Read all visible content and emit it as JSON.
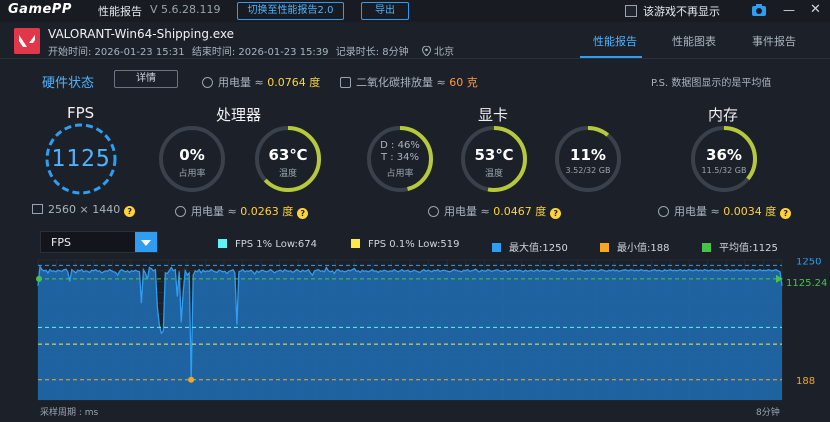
{
  "titlebar": {
    "logo": "GamePP",
    "title": "性能报告",
    "version": "V 5.6.28.119",
    "switch_button": "切换至性能报告2.0",
    "export_button": "导出",
    "hide_checkbox_label": "该游戏不再显示"
  },
  "session": {
    "game_name": "VALORANT-Win64-Shipping.exe",
    "start": "开始时间: 2026-01-23 15:31",
    "end": "结束时间: 2026-01-23 15:39",
    "duration": "记录时长: 8分钟",
    "location": "北京"
  },
  "tabs": [
    "性能报告",
    "性能图表",
    "事件报告"
  ],
  "hardware": {
    "label": "硬件状态",
    "detail_button": "详情",
    "power_label": "用电量 ≈ ",
    "power_value": "0.0764 度",
    "co2_label": "二氧化碳排放量 ≈ ",
    "co2_value": "60 克",
    "note": "P.S. 数据图显示的是平均值"
  },
  "sections": {
    "fps": "FPS",
    "cpu": "处理器",
    "gpu": "显卡",
    "mem": "内存"
  },
  "fps_value": "1125",
  "resolution": "2560 × 1440",
  "cpu": {
    "usage": "0%",
    "usage_label": "占用率",
    "usage_fraction": 0.0,
    "temp": "63℃",
    "temp_label": "温度",
    "temp_fraction": 0.63,
    "power_label": "用电量 ≈ ",
    "power_value": "0.0263 度"
  },
  "gpu": {
    "d_line": "D : 46%",
    "t_line": "T : 34%",
    "usage_label": "占用率",
    "usage_fraction": 0.46,
    "temp": "53℃",
    "temp_label": "温度",
    "temp_fraction": 0.53,
    "vram": "11%",
    "vram_sub": "3.52/32 GB",
    "vram_fraction": 0.11,
    "power_label": "用电量 ≈ ",
    "power_value": "0.0467 度"
  },
  "mem": {
    "usage": "36%",
    "sub": "11.5/32 GB",
    "fraction": 0.36,
    "power_label": "用电量 ≈ ",
    "power_value": "0.0034 度"
  },
  "chart_controls": {
    "selected_metric": "FPS",
    "legend": [
      {
        "label": "FPS 1% Low:674",
        "color": "#5ff2f2"
      },
      {
        "label": "FPS 0.1% Low:519",
        "color": "#ffe84a"
      },
      {
        "label": "最大值:1250",
        "color": "#2f9df2"
      },
      {
        "label": "最小值:188",
        "color": "#f5a623"
      },
      {
        "label": "平均值:1125",
        "color": "#47c24a"
      }
    ]
  },
  "chart_data": {
    "type": "area",
    "metric": "FPS",
    "x_range_minutes": [
      0,
      8
    ],
    "ylim": [
      0,
      1300
    ],
    "reference_lines": {
      "max": 1250,
      "avg": 1125.24,
      "low1": 674,
      "low01": 519,
      "min": 188
    },
    "axis_labels": {
      "max": "1250",
      "avg": "1125.24",
      "min": "188"
    },
    "x_end_label": "8分钟",
    "values": [
      1060,
      1240,
      1210,
      1200,
      1205,
      1180,
      1210,
      1195,
      1200,
      1190,
      1205,
      1200,
      1195,
      1210,
      1215,
      1190,
      1100,
      1210,
      1195,
      1180,
      1205,
      1200,
      1210,
      1190,
      1200,
      1195,
      1185,
      1205,
      1200,
      1210,
      1195,
      1200,
      1180,
      1190,
      1200,
      1195,
      1210,
      1200,
      1190,
      1185,
      1160,
      1195,
      1210,
      1200,
      1190,
      1200,
      1185,
      1200,
      1195,
      1205,
      1195,
      1190,
      900,
      1210,
      1180,
      1120,
      1230,
      1220,
      1200,
      1210,
      860,
      700,
      620,
      640,
      1180,
      1175,
      1200,
      1230,
      1200,
      1210,
      960,
      1195,
      720,
      1000,
      1200,
      1160,
      1180,
      190,
      1160,
      1200,
      1190,
      1210,
      1180,
      1205,
      1190,
      1200,
      1195,
      1210,
      1200,
      1190,
      1185,
      1205,
      1200,
      1190,
      1195,
      1175,
      1195,
      1200,
      1210,
      1180,
      700,
      1190,
      1200,
      1210,
      1190,
      1200,
      1195,
      1205,
      1190,
      1170,
      1200,
      1185,
      1200,
      1205,
      1195,
      1190,
      1200,
      1210,
      1195,
      1180,
      1195,
      1200,
      1205,
      1190,
      1210,
      1200,
      1195,
      1200,
      1185,
      1195,
      1210,
      1200,
      1190,
      1205,
      1195,
      1200,
      1210,
      1180,
      1160,
      1200,
      1205,
      1210,
      1195,
      1200,
      1190,
      1230,
      1200,
      1190,
      1200,
      1175,
      1205,
      1210,
      1195,
      1200,
      1190,
      1195,
      1205,
      1200,
      1210,
      1220,
      1195,
      1200,
      1185,
      1205,
      1195,
      1200,
      1190,
      1200,
      1210,
      1195,
      1200,
      1185,
      1200,
      1195,
      1205,
      1200,
      1190,
      1200,
      1195,
      1210,
      1200,
      1190,
      1200,
      1210,
      1195,
      1200,
      1205,
      1190,
      1195,
      1205,
      1200,
      1190,
      1185,
      1200,
      1210,
      1195,
      1205,
      1200,
      1190,
      1205,
      1200,
      1210,
      1195,
      1200,
      1205,
      1200,
      1195,
      1190,
      1200,
      1210,
      1205,
      1200,
      1195,
      1190,
      1205,
      1200,
      1210,
      1195,
      1200,
      1205,
      1215,
      1200,
      1190,
      1205,
      1200,
      1195,
      1210,
      1205,
      1195,
      1200,
      1205,
      1210,
      1200,
      1195,
      1200,
      1205,
      1190,
      1200,
      1205,
      1200,
      1210,
      1200,
      1205,
      1200,
      1190,
      1205,
      1195,
      1200,
      1205,
      1195,
      1200,
      1210,
      1195,
      1200,
      1205,
      1200,
      1200,
      1195,
      1210,
      1205,
      1200,
      1195,
      1200,
      1205,
      1210,
      1200,
      1205,
      1195,
      1200,
      1205,
      1200,
      1200,
      1210,
      1205,
      1200,
      1195,
      1205,
      1200,
      1210,
      1200,
      1205,
      1195,
      1200,
      1210,
      1205,
      1200,
      1195,
      1205,
      1200,
      1210,
      1200,
      1205,
      1195,
      1200,
      1205,
      1210,
      1205,
      1200,
      1210,
      1205,
      1200,
      1205,
      1200,
      1210,
      1205,
      1200,
      1205,
      1195,
      1200,
      1205,
      1210,
      1200,
      1205,
      1200,
      1195,
      1210,
      1200,
      1205,
      1210,
      1200,
      1205,
      1200,
      1205,
      1210,
      1200,
      1205,
      1200,
      1210,
      1205,
      1200,
      1205,
      1210,
      1200,
      1205,
      1200,
      1210,
      1205,
      1200,
      1205,
      1210,
      1200,
      1205,
      1200,
      1210,
      1205,
      1200,
      1205,
      1210,
      1200,
      1205,
      1200,
      1210,
      1205,
      1200,
      1205,
      1210,
      1200,
      1205,
      1200,
      1210,
      1205,
      1200,
      1205,
      1210,
      1200,
      1205,
      1200,
      1210,
      1205,
      1200,
      1205,
      1210,
      1200,
      1190,
      1060
    ]
  },
  "footer": {
    "sampling": "采样周期 : ms",
    "end": "8分钟"
  }
}
